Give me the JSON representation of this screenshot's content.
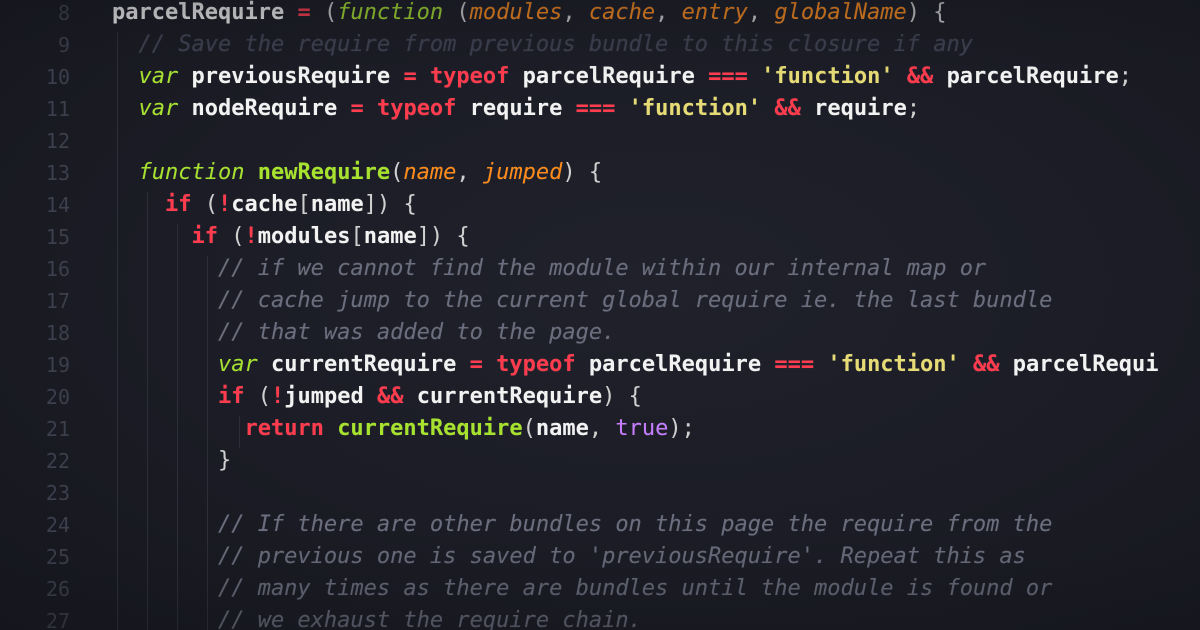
{
  "lines": [
    {
      "num": "8",
      "tokens": [
        {
          "t": "parcelRequire",
          "c": "var"
        },
        {
          "t": " ",
          "c": "sp"
        },
        {
          "t": "=",
          "c": "op"
        },
        {
          "t": " ",
          "c": "sp"
        },
        {
          "t": "(",
          "c": "punc"
        },
        {
          "t": "function",
          "c": "kwi"
        },
        {
          "t": " ",
          "c": "sp"
        },
        {
          "t": "(",
          "c": "punc"
        },
        {
          "t": "modules",
          "c": "param"
        },
        {
          "t": ", ",
          "c": "punc"
        },
        {
          "t": "cache",
          "c": "param"
        },
        {
          "t": ", ",
          "c": "punc"
        },
        {
          "t": "entry",
          "c": "param"
        },
        {
          "t": ", ",
          "c": "punc"
        },
        {
          "t": "globalName",
          "c": "param"
        },
        {
          "t": ") {",
          "c": "punc"
        }
      ]
    },
    {
      "num": "9",
      "tokens": [
        {
          "t": "  // Save the require from previous bundle to this closure if any",
          "c": "cmtfaint"
        }
      ]
    },
    {
      "num": "10",
      "tokens": [
        {
          "t": "  ",
          "c": "sp"
        },
        {
          "t": "var",
          "c": "kwi"
        },
        {
          "t": " ",
          "c": "sp"
        },
        {
          "t": "previousRequire",
          "c": "var"
        },
        {
          "t": " ",
          "c": "sp"
        },
        {
          "t": "=",
          "c": "op"
        },
        {
          "t": " ",
          "c": "sp"
        },
        {
          "t": "typeof",
          "c": "kw"
        },
        {
          "t": " ",
          "c": "sp"
        },
        {
          "t": "parcelRequire",
          "c": "var"
        },
        {
          "t": " ",
          "c": "sp"
        },
        {
          "t": "===",
          "c": "op"
        },
        {
          "t": " ",
          "c": "sp"
        },
        {
          "t": "'function'",
          "c": "str"
        },
        {
          "t": " ",
          "c": "sp"
        },
        {
          "t": "&&",
          "c": "op"
        },
        {
          "t": " ",
          "c": "sp"
        },
        {
          "t": "parcelRequire",
          "c": "var"
        },
        {
          "t": ";",
          "c": "punc"
        }
      ]
    },
    {
      "num": "11",
      "tokens": [
        {
          "t": "  ",
          "c": "sp"
        },
        {
          "t": "var",
          "c": "kwi"
        },
        {
          "t": " ",
          "c": "sp"
        },
        {
          "t": "nodeRequire",
          "c": "var"
        },
        {
          "t": " ",
          "c": "sp"
        },
        {
          "t": "=",
          "c": "op"
        },
        {
          "t": " ",
          "c": "sp"
        },
        {
          "t": "typeof",
          "c": "kw"
        },
        {
          "t": " ",
          "c": "sp"
        },
        {
          "t": "require",
          "c": "var"
        },
        {
          "t": " ",
          "c": "sp"
        },
        {
          "t": "===",
          "c": "op"
        },
        {
          "t": " ",
          "c": "sp"
        },
        {
          "t": "'function'",
          "c": "str"
        },
        {
          "t": " ",
          "c": "sp"
        },
        {
          "t": "&&",
          "c": "op"
        },
        {
          "t": " ",
          "c": "sp"
        },
        {
          "t": "require",
          "c": "var"
        },
        {
          "t": ";",
          "c": "punc"
        }
      ]
    },
    {
      "num": "12",
      "tokens": []
    },
    {
      "num": "13",
      "tokens": [
        {
          "t": "  ",
          "c": "sp"
        },
        {
          "t": "function",
          "c": "kwi"
        },
        {
          "t": " ",
          "c": "sp"
        },
        {
          "t": "newRequire",
          "c": "fn"
        },
        {
          "t": "(",
          "c": "punc"
        },
        {
          "t": "name",
          "c": "param"
        },
        {
          "t": ", ",
          "c": "punc"
        },
        {
          "t": "jumped",
          "c": "param"
        },
        {
          "t": ") {",
          "c": "punc"
        }
      ]
    },
    {
      "num": "14",
      "tokens": [
        {
          "t": "    ",
          "c": "sp"
        },
        {
          "t": "if",
          "c": "kw"
        },
        {
          "t": " (",
          "c": "punc"
        },
        {
          "t": "!",
          "c": "op"
        },
        {
          "t": "cache",
          "c": "var"
        },
        {
          "t": "[",
          "c": "punc"
        },
        {
          "t": "name",
          "c": "var"
        },
        {
          "t": "]) {",
          "c": "punc"
        }
      ]
    },
    {
      "num": "15",
      "tokens": [
        {
          "t": "      ",
          "c": "sp"
        },
        {
          "t": "if",
          "c": "kw"
        },
        {
          "t": " (",
          "c": "punc"
        },
        {
          "t": "!",
          "c": "op"
        },
        {
          "t": "modules",
          "c": "var"
        },
        {
          "t": "[",
          "c": "punc"
        },
        {
          "t": "name",
          "c": "var"
        },
        {
          "t": "]) {",
          "c": "punc"
        }
      ]
    },
    {
      "num": "16",
      "tokens": [
        {
          "t": "        // if we cannot find the module within our internal map or",
          "c": "cmt"
        }
      ]
    },
    {
      "num": "17",
      "tokens": [
        {
          "t": "        // cache jump to the current global require ie. the last bundle",
          "c": "cmt"
        }
      ]
    },
    {
      "num": "18",
      "tokens": [
        {
          "t": "        // that was added to the page.",
          "c": "cmt"
        }
      ]
    },
    {
      "num": "19",
      "tokens": [
        {
          "t": "        ",
          "c": "sp"
        },
        {
          "t": "var",
          "c": "kwi"
        },
        {
          "t": " ",
          "c": "sp"
        },
        {
          "t": "currentRequire",
          "c": "var"
        },
        {
          "t": " ",
          "c": "sp"
        },
        {
          "t": "=",
          "c": "op"
        },
        {
          "t": " ",
          "c": "sp"
        },
        {
          "t": "typeof",
          "c": "kw"
        },
        {
          "t": " ",
          "c": "sp"
        },
        {
          "t": "parcelRequire",
          "c": "var"
        },
        {
          "t": " ",
          "c": "sp"
        },
        {
          "t": "===",
          "c": "op"
        },
        {
          "t": " ",
          "c": "sp"
        },
        {
          "t": "'function'",
          "c": "str"
        },
        {
          "t": " ",
          "c": "sp"
        },
        {
          "t": "&&",
          "c": "op"
        },
        {
          "t": " ",
          "c": "sp"
        },
        {
          "t": "parcelRequi",
          "c": "var"
        }
      ]
    },
    {
      "num": "20",
      "tokens": [
        {
          "t": "        ",
          "c": "sp"
        },
        {
          "t": "if",
          "c": "kw"
        },
        {
          "t": " (",
          "c": "punc"
        },
        {
          "t": "!",
          "c": "op"
        },
        {
          "t": "jumped",
          "c": "var"
        },
        {
          "t": " ",
          "c": "sp"
        },
        {
          "t": "&&",
          "c": "op"
        },
        {
          "t": " ",
          "c": "sp"
        },
        {
          "t": "currentRequire",
          "c": "var"
        },
        {
          "t": ") {",
          "c": "punc"
        }
      ]
    },
    {
      "num": "21",
      "tokens": [
        {
          "t": "          ",
          "c": "sp"
        },
        {
          "t": "return",
          "c": "kw"
        },
        {
          "t": " ",
          "c": "sp"
        },
        {
          "t": "currentRequire",
          "c": "fn"
        },
        {
          "t": "(",
          "c": "punc"
        },
        {
          "t": "name",
          "c": "var"
        },
        {
          "t": ", ",
          "c": "punc"
        },
        {
          "t": "true",
          "c": "bool"
        },
        {
          "t": ");",
          "c": "punc"
        }
      ]
    },
    {
      "num": "22",
      "tokens": [
        {
          "t": "        ",
          "c": "sp"
        },
        {
          "t": "}",
          "c": "punc"
        }
      ]
    },
    {
      "num": "23",
      "tokens": []
    },
    {
      "num": "24",
      "tokens": [
        {
          "t": "        // If there are other bundles on this page the require from the",
          "c": "cmt"
        }
      ]
    },
    {
      "num": "25",
      "tokens": [
        {
          "t": "        // previous one is saved to 'previousRequire'. Repeat this as",
          "c": "cmt"
        }
      ]
    },
    {
      "num": "26",
      "tokens": [
        {
          "t": "        // many times as there are bundles until the module is found or",
          "c": "cmt"
        }
      ]
    },
    {
      "num": "27",
      "tokens": [
        {
          "t": "        // we exhaust the require chain.",
          "c": "cmt"
        }
      ]
    }
  ]
}
